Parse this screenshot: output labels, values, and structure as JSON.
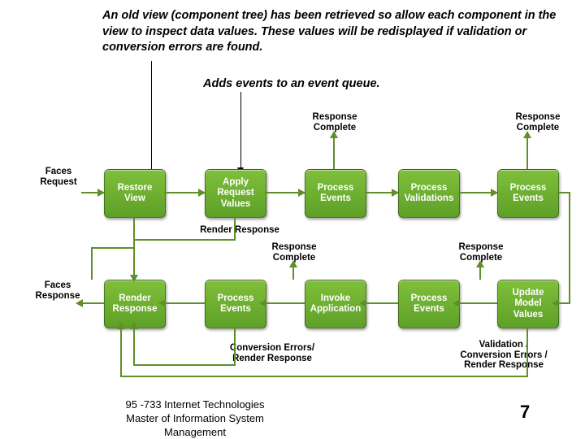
{
  "descriptions": {
    "main": "An old view (component tree) has been retrieved so allow each component in the view to inspect data values. These values will be redisplayed if validation or conversion errors are found.",
    "sub": "Adds events to an event queue."
  },
  "labels": {
    "faces_request": "Faces\nRequest",
    "faces_response": "Faces\nResponse",
    "response_complete": "Response\nComplete",
    "render_response": "Render Response",
    "conversion_errors": "Conversion Errors/\nRender Response",
    "validation_errors": "Validation /\nConversion Errors /\nRender Response"
  },
  "boxes": {
    "restore_view": "Restore\nView",
    "apply_request": "Apply\nRequest\nValues",
    "process_events_1": "Process\nEvents",
    "process_validations": "Process\nValidations",
    "process_events_2": "Process\nEvents",
    "render_response_box": "Render\nResponse",
    "process_events_4": "Process\nEvents",
    "invoke_application": "Invoke\nApplication",
    "process_events_3": "Process\nEvents",
    "update_model": "Update\nModel\nValues"
  },
  "footer": {
    "line1": "95 -733 Internet Technologies",
    "line2": "Master of Information System Management"
  },
  "page_number": "7"
}
